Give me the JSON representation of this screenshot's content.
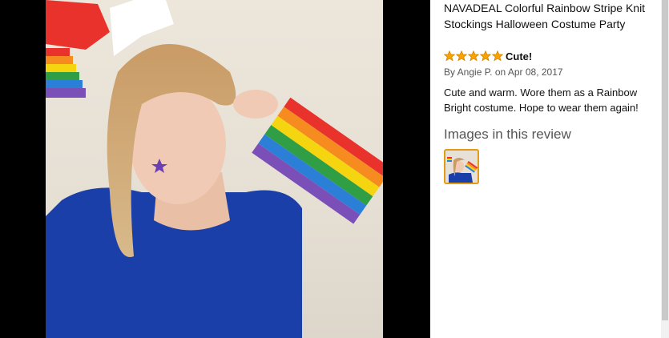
{
  "review": {
    "product_title": "NAVADEAL Colorful Rainbow Stripe Knit Stockings Halloween Costume Party",
    "rating": 5,
    "headline": "Cute!",
    "byline": "By Angie P. on Apr 08, 2017",
    "body": "Cute and warm. Wore them as a Rainbow Bright costume. Hope to wear them again!",
    "images_heading": "Images in this review",
    "star_color": "#f7a400"
  }
}
